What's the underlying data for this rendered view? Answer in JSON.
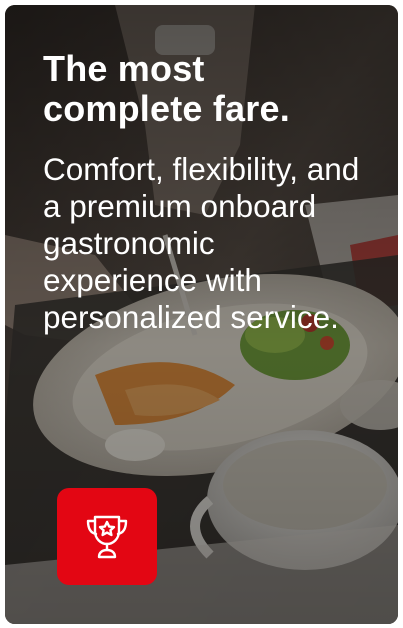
{
  "card": {
    "title": "The most complete fare.",
    "description": "Comfort, flexibility, and a premium onboard gastronomic experience with personalized service.",
    "badge_icon": "trophy-star-icon",
    "accent_color": "#e30613"
  }
}
